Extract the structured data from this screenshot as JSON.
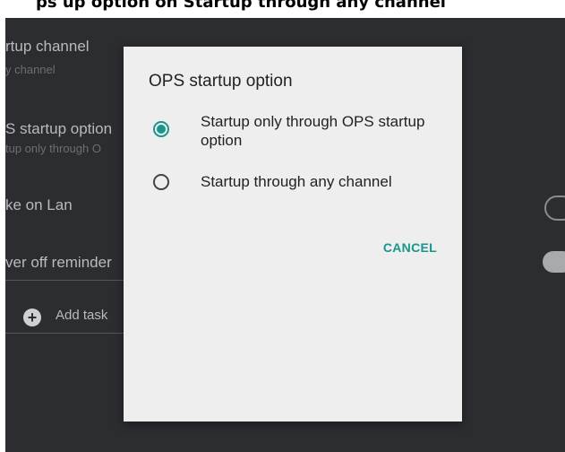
{
  "caption": "ps up option on Startup through any channel",
  "background": {
    "items": [
      {
        "label": "rtup channel",
        "sub": "y channel"
      },
      {
        "label": "S startup option",
        "sub": "tup only through O"
      },
      {
        "label": "ke on Lan"
      },
      {
        "label": "ver off reminder"
      }
    ],
    "add_task": {
      "label": "Add task",
      "icon": "plus-icon"
    }
  },
  "dialog": {
    "title": "OPS startup option",
    "options": [
      {
        "label": "Startup only through OPS startup option",
        "selected": true
      },
      {
        "label": "Startup through any channel",
        "selected": false
      }
    ],
    "cancel_label": "CANCEL"
  },
  "colors": {
    "accent": "#17978c",
    "screen_bg": "#2c2d31",
    "dialog_bg": "#eeeeee"
  }
}
